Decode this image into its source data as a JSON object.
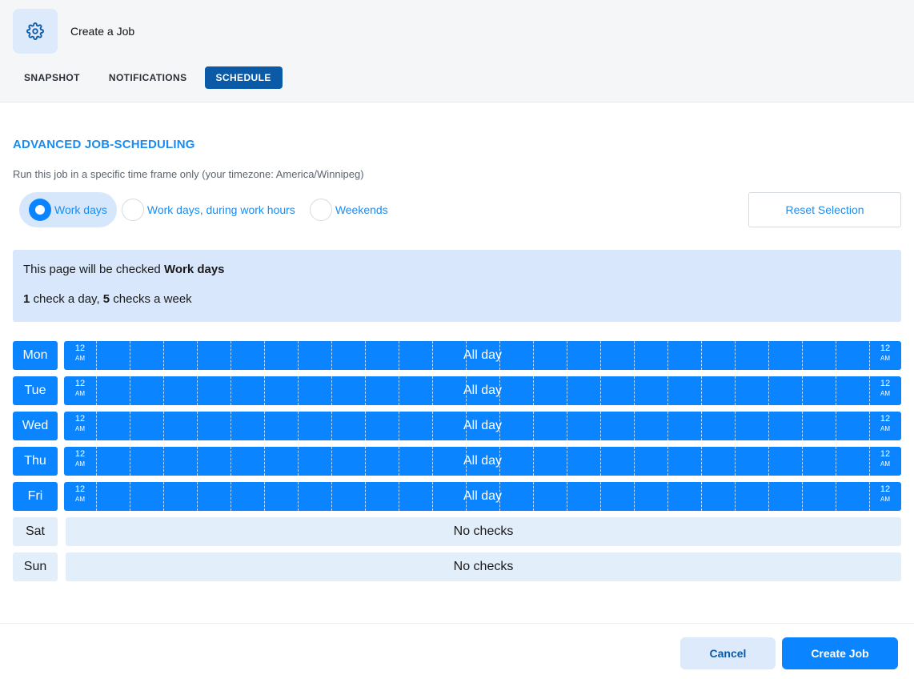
{
  "header": {
    "title": "Create a Job",
    "icon": "gear-icon",
    "tabs": [
      {
        "label": "SNAPSHOT",
        "active": false
      },
      {
        "label": "NOTIFICATIONS",
        "active": false
      },
      {
        "label": "SCHEDULE",
        "active": true
      }
    ]
  },
  "section": {
    "title": "ADVANCED JOB-SCHEDULING",
    "subtitle": "Run this job in a specific time frame only (your timezone: America/Winnipeg)"
  },
  "radio_options": [
    {
      "label": "Work days",
      "selected": true
    },
    {
      "label": "Work days, during work hours",
      "selected": false
    },
    {
      "label": "Weekends",
      "selected": false
    }
  ],
  "reset_label": "Reset Selection",
  "info": {
    "prefix": "This page will be checked ",
    "mode": "Work days",
    "per_day": "1",
    "per_day_text": " check a day, ",
    "per_week": "5",
    "per_week_text": " checks a week"
  },
  "schedule": [
    {
      "day": "Mon",
      "active": true,
      "label": "All day",
      "start_hour": "12",
      "start_ampm": "AM",
      "end_hour": "12",
      "end_ampm": "AM"
    },
    {
      "day": "Tue",
      "active": true,
      "label": "All day",
      "start_hour": "12",
      "start_ampm": "AM",
      "end_hour": "12",
      "end_ampm": "AM"
    },
    {
      "day": "Wed",
      "active": true,
      "label": "All day",
      "start_hour": "12",
      "start_ampm": "AM",
      "end_hour": "12",
      "end_ampm": "AM"
    },
    {
      "day": "Thu",
      "active": true,
      "label": "All day",
      "start_hour": "12",
      "start_ampm": "AM",
      "end_hour": "12",
      "end_ampm": "AM"
    },
    {
      "day": "Fri",
      "active": true,
      "label": "All day",
      "start_hour": "12",
      "start_ampm": "AM",
      "end_hour": "12",
      "end_ampm": "AM"
    },
    {
      "day": "Sat",
      "active": false,
      "label": "No checks"
    },
    {
      "day": "Sun",
      "active": false,
      "label": "No checks"
    }
  ],
  "footer": {
    "cancel_label": "Cancel",
    "create_label": "Create Job"
  },
  "colors": {
    "accent": "#0a84ff",
    "tab_active": "#0a5aa8",
    "info_bg": "#d8e7fb"
  }
}
